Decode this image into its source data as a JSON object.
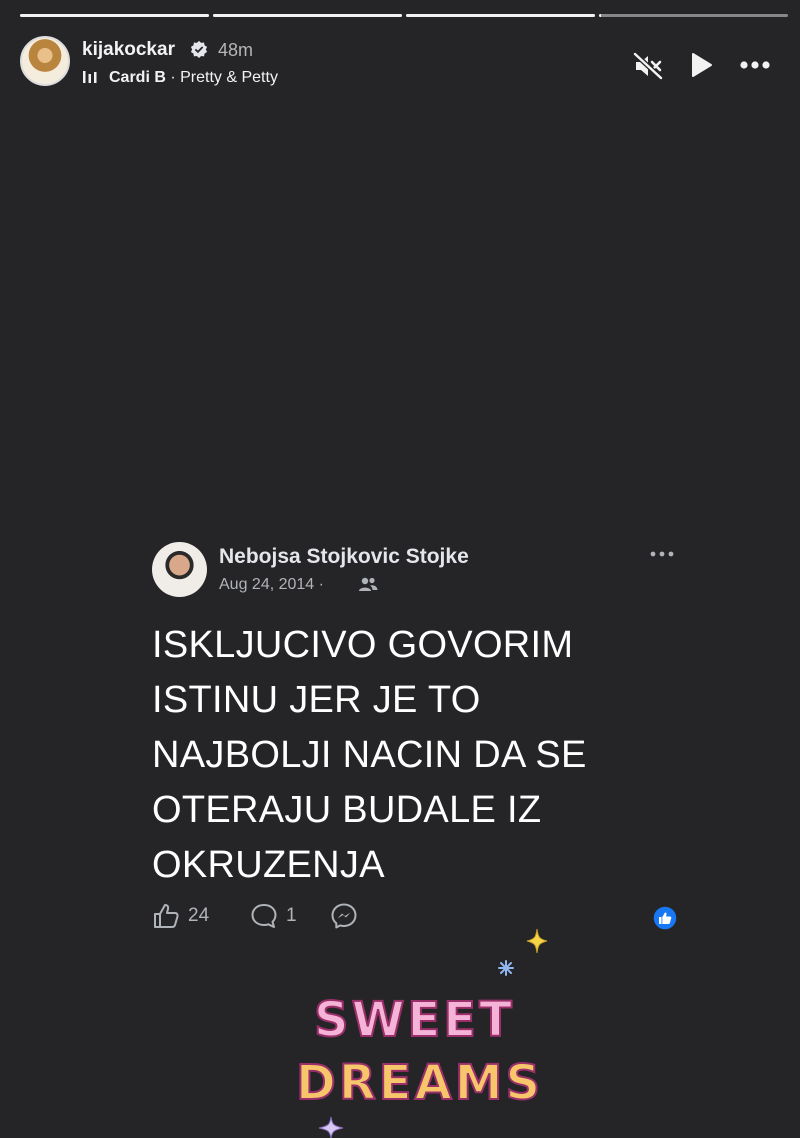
{
  "story": {
    "progress": [
      1,
      1,
      1,
      0.01
    ],
    "username": "kijakockar",
    "time": "48m",
    "music": {
      "artist": "Cardi B",
      "separator": " · ",
      "title": "Pretty & Petty"
    }
  },
  "icons": {
    "verified": "verified-badge-icon",
    "music": "music-bars-icon",
    "mute": "speaker-muted-icon",
    "play": "play-icon",
    "more": "ellipsis-icon"
  },
  "post": {
    "author": "Nebojsa Stojkovic Stojke",
    "date": "Aug 24, 2014 ·",
    "audience_icon": "friends-icon",
    "lines": [
      "ISKLJUCIVO GOVORIM",
      "ISTINU JER JE TO",
      "NAJBOLJI NACIN DA SE",
      "OTERAJU BUDALE IZ",
      "OKRUZENJA"
    ],
    "likes": "24",
    "comments": "1",
    "reaction_icon": "like-reaction-icon"
  },
  "sticker": {
    "line1": "SWEET",
    "line2": "DREAMS"
  },
  "colors": {
    "background": "#252527",
    "like_blue": "#1877f2"
  }
}
